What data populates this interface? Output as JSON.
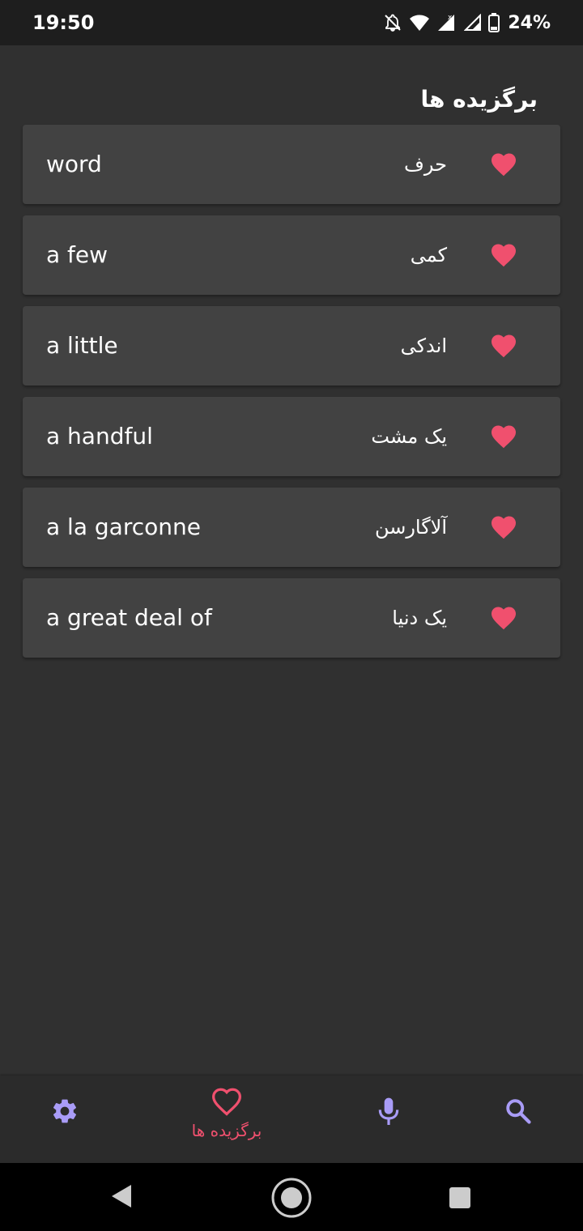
{
  "status": {
    "time": "19:50",
    "battery": "24%",
    "icons": [
      "notifications-off-icon",
      "wifi-icon",
      "signal-icon",
      "signal-icon",
      "battery-icon"
    ]
  },
  "title": "برگزیده ها",
  "favorites": [
    {
      "word": "word",
      "translation": "حرف"
    },
    {
      "word": "a few",
      "translation": "کمی"
    },
    {
      "word": "a little",
      "translation": "اندکی"
    },
    {
      "word": "a handful",
      "translation": "یک مشت"
    },
    {
      "word": "a la garconne",
      "translation": "آلاگارسن"
    },
    {
      "word": "a great deal of",
      "translation": "یک دنیا"
    }
  ],
  "bottom_nav": {
    "favorites_label": "برگزیده ها",
    "items": [
      "settings-icon",
      "heart-icon",
      "mic-icon",
      "search-icon"
    ]
  },
  "colors": {
    "background": "#303030",
    "card": "#424242",
    "heart": "#f0506e",
    "nav_icon": "#a99cf7"
  }
}
